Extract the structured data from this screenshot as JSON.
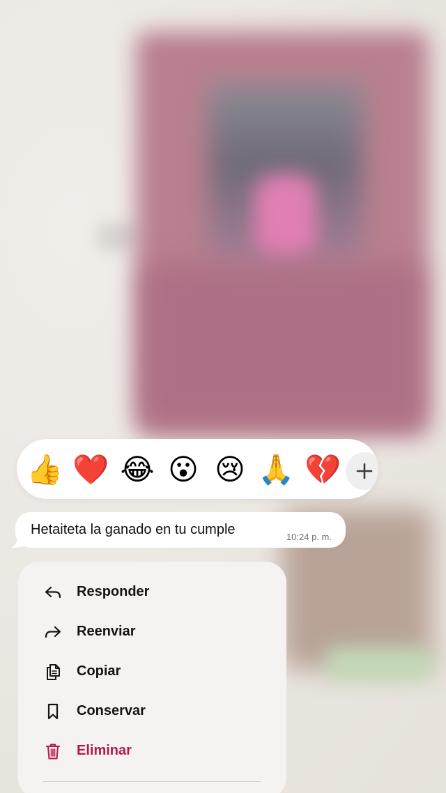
{
  "background": {
    "description_colors": {
      "photo": "#b9808f",
      "wall": "#ece8e3"
    }
  },
  "reactions": {
    "items": [
      {
        "emoji": "👍",
        "name": "thumbs-up"
      },
      {
        "emoji": "❤️",
        "name": "red-heart"
      },
      {
        "emoji": "😂",
        "name": "tears-of-joy"
      },
      {
        "emoji": "😮",
        "name": "surprised"
      },
      {
        "emoji": "😢",
        "name": "crying"
      },
      {
        "emoji": "🙏",
        "name": "folded-hands"
      },
      {
        "emoji": "💔",
        "name": "broken-heart"
      }
    ],
    "more_icon": "plus-icon"
  },
  "message": {
    "text": "Hetaiteta la ganado en tu cumple",
    "time": "10:24 p. m."
  },
  "menu": {
    "items": [
      {
        "label": "Responder",
        "icon": "reply-icon"
      },
      {
        "label": "Reenviar",
        "icon": "forward-icon"
      },
      {
        "label": "Copiar",
        "icon": "copy-icon"
      },
      {
        "label": "Conservar",
        "icon": "bookmark-icon"
      },
      {
        "label": "Eliminar",
        "icon": "trash-icon"
      }
    ],
    "danger_color": "#b5184f"
  }
}
